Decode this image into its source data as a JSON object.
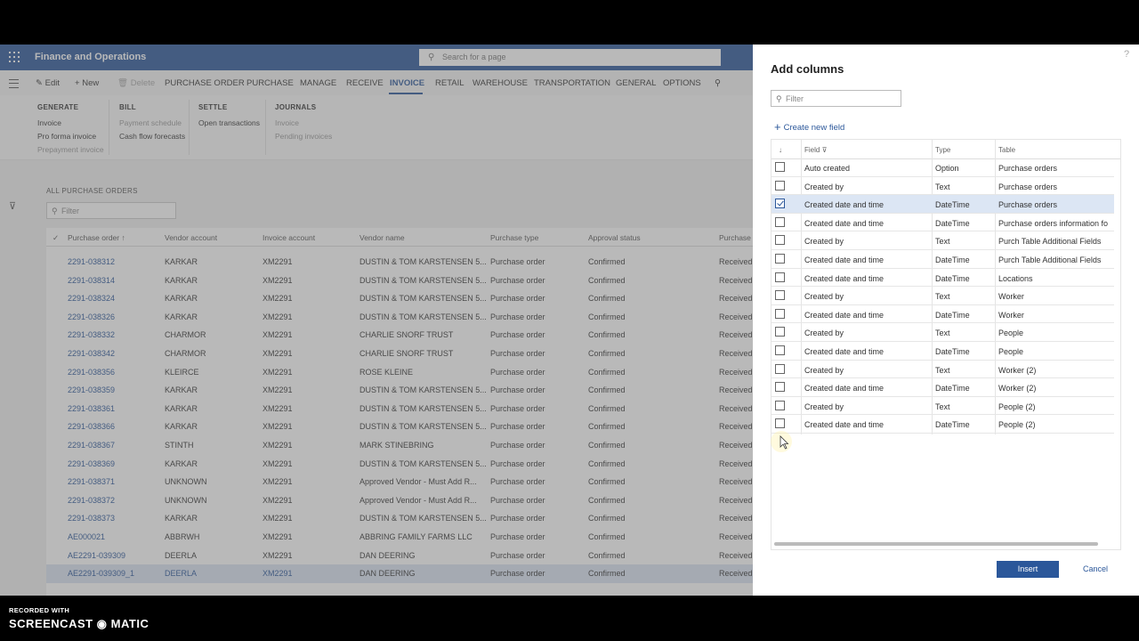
{
  "app": {
    "title": "Finance and Operations",
    "search_placeholder": "Search for a page",
    "actions": {
      "edit": "Edit",
      "new": "New",
      "delete": "Delete",
      "tabs": [
        "PURCHASE ORDER",
        "PURCHASE",
        "MANAGE",
        "RECEIVE",
        "INVOICE",
        "RETAIL",
        "WAREHOUSE",
        "TRANSPORTATION",
        "GENERAL",
        "OPTIONS"
      ],
      "active_tab": "INVOICE"
    },
    "ribbon": {
      "groups": [
        {
          "title": "GENERATE",
          "items": [
            "Invoice",
            "Pro forma invoice",
            "Prepayment invoice"
          ]
        },
        {
          "title": "BILL",
          "items": [
            "Payment schedule",
            "Cash flow forecasts"
          ]
        },
        {
          "title": "SETTLE",
          "items": [
            "Open transactions"
          ]
        },
        {
          "title": "JOURNALS",
          "items": [
            "Invoice",
            "Pending invoices"
          ]
        }
      ]
    },
    "page": {
      "breadcrumb": "ALL PURCHASE ORDERS",
      "filter_placeholder": "Filter"
    },
    "grid": {
      "columns": [
        "Purchase order",
        "Vendor account",
        "Invoice account",
        "Vendor name",
        "Purchase type",
        "Approval status",
        "Purchase o"
      ],
      "rows": [
        [
          "2291-038312",
          "KARKAR",
          "XM2291",
          "DUSTIN & TOM KARSTENSEN 5...",
          "Purchase order",
          "Confirmed",
          "Received"
        ],
        [
          "2291-038314",
          "KARKAR",
          "XM2291",
          "DUSTIN & TOM KARSTENSEN 5...",
          "Purchase order",
          "Confirmed",
          "Received"
        ],
        [
          "2291-038324",
          "KARKAR",
          "XM2291",
          "DUSTIN & TOM KARSTENSEN 5...",
          "Purchase order",
          "Confirmed",
          "Received"
        ],
        [
          "2291-038326",
          "KARKAR",
          "XM2291",
          "DUSTIN & TOM KARSTENSEN 5...",
          "Purchase order",
          "Confirmed",
          "Received"
        ],
        [
          "2291-038332",
          "CHARMOR",
          "XM2291",
          "CHARLIE SNORF TRUST",
          "Purchase order",
          "Confirmed",
          "Received"
        ],
        [
          "2291-038342",
          "CHARMOR",
          "XM2291",
          "CHARLIE SNORF TRUST",
          "Purchase order",
          "Confirmed",
          "Received"
        ],
        [
          "2291-038356",
          "KLEIRCE",
          "XM2291",
          "ROSE KLEINE",
          "Purchase order",
          "Confirmed",
          "Received"
        ],
        [
          "2291-038359",
          "KARKAR",
          "XM2291",
          "DUSTIN & TOM KARSTENSEN 5...",
          "Purchase order",
          "Confirmed",
          "Received"
        ],
        [
          "2291-038361",
          "KARKAR",
          "XM2291",
          "DUSTIN & TOM KARSTENSEN 5...",
          "Purchase order",
          "Confirmed",
          "Received"
        ],
        [
          "2291-038366",
          "KARKAR",
          "XM2291",
          "DUSTIN & TOM KARSTENSEN 5...",
          "Purchase order",
          "Confirmed",
          "Received"
        ],
        [
          "2291-038367",
          "STINTH",
          "XM2291",
          "MARK STINEBRING",
          "Purchase order",
          "Confirmed",
          "Received"
        ],
        [
          "2291-038369",
          "KARKAR",
          "XM2291",
          "DUSTIN & TOM KARSTENSEN 5...",
          "Purchase order",
          "Confirmed",
          "Received"
        ],
        [
          "2291-038371",
          "UNKNOWN",
          "XM2291",
          "Approved Vendor - Must Add R...",
          "Purchase order",
          "Confirmed",
          "Received"
        ],
        [
          "2291-038372",
          "UNKNOWN",
          "XM2291",
          "Approved Vendor - Must Add R...",
          "Purchase order",
          "Confirmed",
          "Received"
        ],
        [
          "2291-038373",
          "KARKAR",
          "XM2291",
          "DUSTIN & TOM KARSTENSEN 5...",
          "Purchase order",
          "Confirmed",
          "Received"
        ],
        [
          "AE000021",
          "ABBRWH",
          "XM2291",
          "ABBRING FAMILY FARMS LLC",
          "Purchase order",
          "Confirmed",
          "Received"
        ],
        [
          "AE2291-039309",
          "DEERLA",
          "XM2291",
          "DAN DEERING",
          "Purchase order",
          "Confirmed",
          "Received"
        ],
        [
          "AE2291-039309_1",
          "DEERLA",
          "XM2291",
          "DAN DEERING",
          "Purchase order",
          "Confirmed",
          "Received"
        ]
      ],
      "selected_row": 17
    }
  },
  "panel": {
    "title": "Add columns",
    "help": "?",
    "filter_placeholder": "Filter",
    "create_new_field": "Create new field",
    "columns": [
      "Field",
      "Type",
      "Table"
    ],
    "rows": [
      {
        "field": "Auto created",
        "type": "Option",
        "table": "Purchase orders",
        "checked": false
      },
      {
        "field": "Created by",
        "type": "Text",
        "table": "Purchase orders",
        "checked": false
      },
      {
        "field": "Created date and time",
        "type": "DateTime",
        "table": "Purchase orders",
        "checked": true
      },
      {
        "field": "Created date and time",
        "type": "DateTime",
        "table": "Purchase orders information fo",
        "checked": false
      },
      {
        "field": "Created by",
        "type": "Text",
        "table": "Purch Table Additional Fields",
        "checked": false
      },
      {
        "field": "Created date and time",
        "type": "DateTime",
        "table": "Purch Table Additional Fields",
        "checked": false
      },
      {
        "field": "Created date and time",
        "type": "DateTime",
        "table": "Locations",
        "checked": false
      },
      {
        "field": "Created by",
        "type": "Text",
        "table": "Worker",
        "checked": false
      },
      {
        "field": "Created date and time",
        "type": "DateTime",
        "table": "Worker",
        "checked": false
      },
      {
        "field": "Created by",
        "type": "Text",
        "table": "People",
        "checked": false
      },
      {
        "field": "Created date and time",
        "type": "DateTime",
        "table": "People",
        "checked": false
      },
      {
        "field": "Created by",
        "type": "Text",
        "table": "Worker (2)",
        "checked": false
      },
      {
        "field": "Created date and time",
        "type": "DateTime",
        "table": "Worker (2)",
        "checked": false
      },
      {
        "field": "Created by",
        "type": "Text",
        "table": "People (2)",
        "checked": false
      },
      {
        "field": "Created date and time",
        "type": "DateTime",
        "table": "People (2)",
        "checked": false
      }
    ],
    "insert": "Insert",
    "cancel": "Cancel"
  },
  "watermark": {
    "line1": "RECORDED WITH",
    "line2": "SCREENCAST ◉ MATIC"
  },
  "colors": {
    "brand": "#2b579a",
    "selected_row": "#dce6f4"
  }
}
